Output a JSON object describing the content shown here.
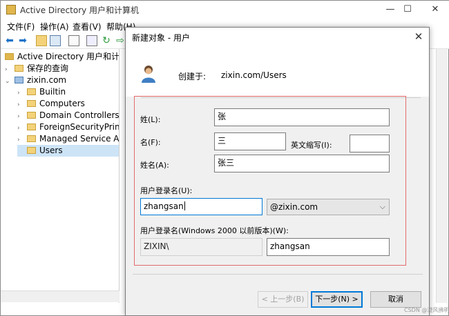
{
  "app": {
    "title": "Active Directory 用户和计算机",
    "caption_minimize": "—",
    "caption_maximize": "☐",
    "caption_close": "✕"
  },
  "menu": [
    "文件(F)",
    "操作(A)",
    "查看(V)",
    "帮助(H)"
  ],
  "toolbar_icons": [
    "back-arrow-icon",
    "forward-arrow-icon",
    "folder-up-icon",
    "console-tree-icon",
    "copy-icon",
    "properties-icon",
    "refresh-icon",
    "export-icon"
  ],
  "tree": {
    "root": "Active Directory 用户和计算机",
    "saved_queries": "保存的查询",
    "domain": "zixin.com",
    "children": [
      "Builtin",
      "Computers",
      "Domain Controllers",
      "ForeignSecurityPrincipa",
      "Managed Service Acco",
      "Users"
    ]
  },
  "dialog": {
    "title": "新建对象 - 用户",
    "create_in_label": "创建于:",
    "create_in_value": "zixin.com/Users",
    "last_name_label": "姓(L):",
    "last_name_value": "张",
    "first_name_label": "名(F):",
    "first_name_value": "三",
    "initials_label": "英文缩写(I):",
    "initials_value": "",
    "full_name_label": "姓名(A):",
    "full_name_value": "张三",
    "logon_name_label": "用户登录名(U):",
    "logon_name_value": "zhangsan",
    "domain_suffix": "@zixin.com",
    "pre2000_label": "用户登录名(Windows 2000 以前版本)(W):",
    "pre2000_domain": "ZIXIN\\",
    "pre2000_name": "zhangsan",
    "back_button": "< 上一步(B)",
    "next_button": "下一步(N) >",
    "cancel_button": "取消"
  },
  "watermark": "CSDN @澄风拂明月",
  "colors": {
    "accent": "#0078d7",
    "highlight_border": "#e36a6a",
    "dialog_bg": "#f0f0f0",
    "selection": "#cde4f7"
  }
}
